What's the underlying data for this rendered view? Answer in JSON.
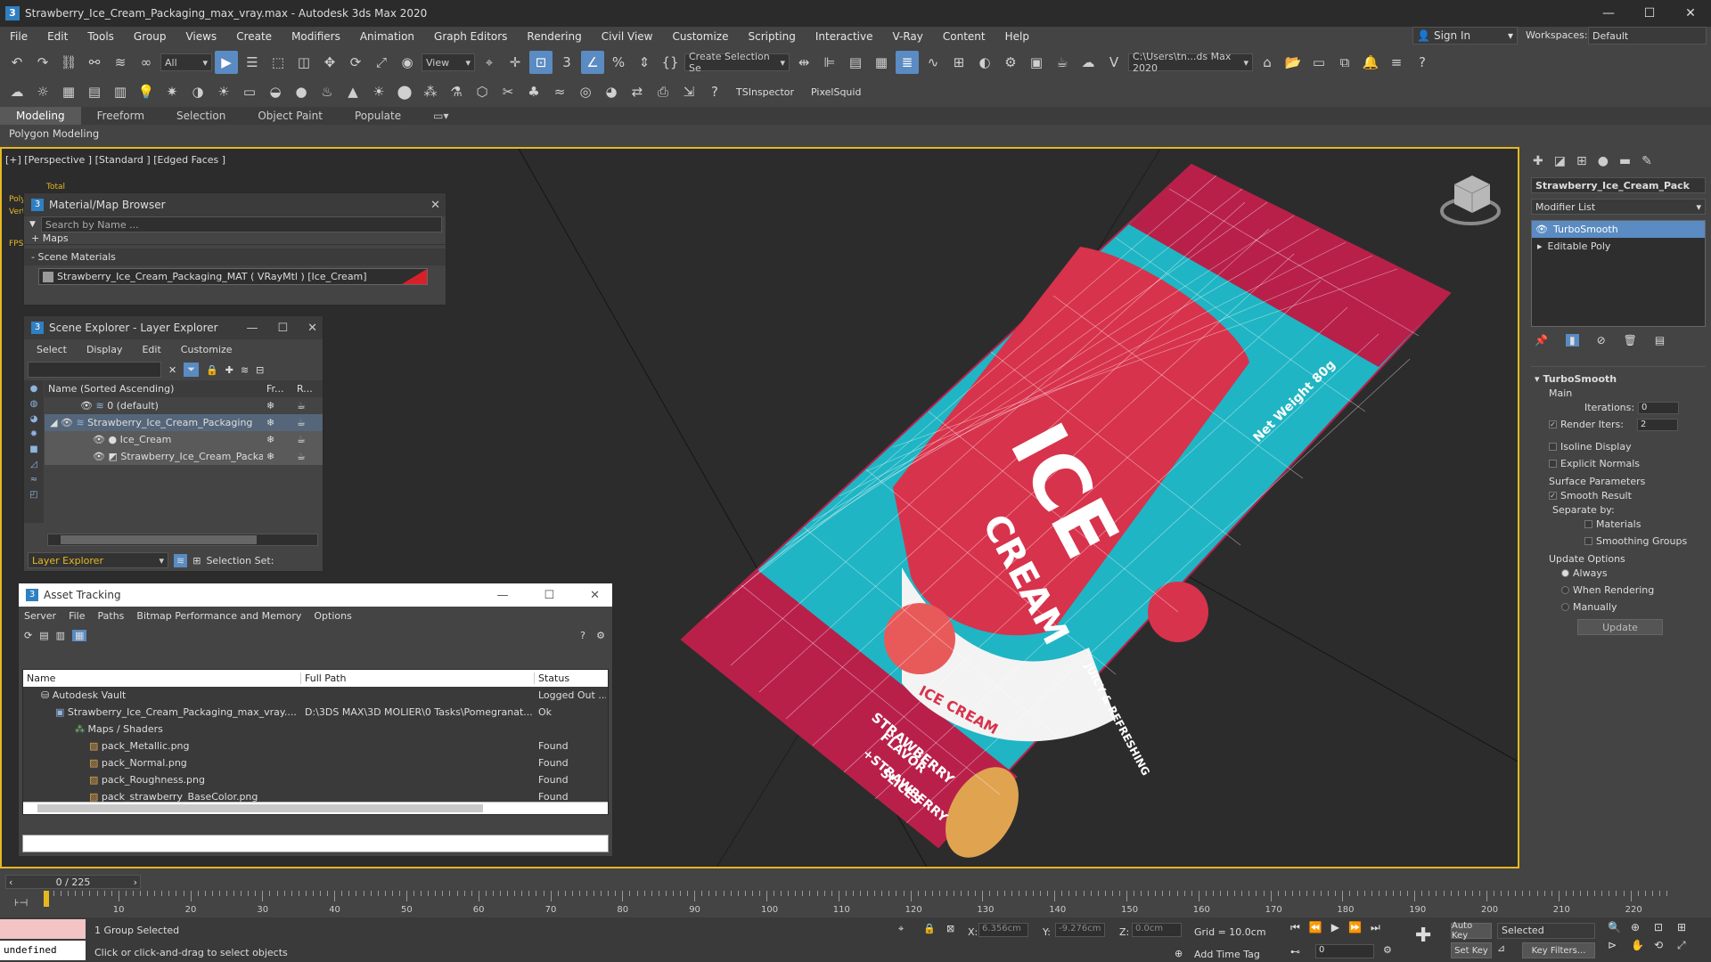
{
  "window": {
    "title": "Strawberry_Ice_Cream_Packaging_max_vray.max - Autodesk 3ds Max 2020",
    "app_icon": "3",
    "minimize": "—",
    "maximize": "☐",
    "close": "✕"
  },
  "menubar": [
    "File",
    "Edit",
    "Tools",
    "Group",
    "Views",
    "Create",
    "Modifiers",
    "Animation",
    "Graph Editors",
    "Rendering",
    "Civil View",
    "Customize",
    "Scripting",
    "Interactive",
    "V-Ray",
    "Content",
    "Help"
  ],
  "signin": {
    "label": "Sign In"
  },
  "workspaces": {
    "label": "Workspaces:",
    "value": "Default"
  },
  "toolbar1": {
    "selection_filter": "All",
    "ref_coord": "View",
    "named_selection": "Create Selection Se",
    "path": "C:\\Users\\tn...ds Max 2020"
  },
  "toolbar2": {
    "tsinspector": "TSInspector",
    "pixelsquid": "PixelSquid"
  },
  "ribbon": {
    "tabs": [
      "Modeling",
      "Freeform",
      "Selection",
      "Object Paint",
      "Populate"
    ],
    "active": "Modeling",
    "subtitle": "Polygon Modeling"
  },
  "viewport": {
    "label": "[+] [Perspective ] [Standard ] [Edged Faces ]",
    "stats_total": "Total",
    "stats_labels": [
      "Poly",
      "Vert",
      "FPS"
    ],
    "pack_text": {
      "line1": "ICE",
      "line2": "CREAM",
      "badge": "JUICY & REFRESHING",
      "small": "ICE CREAM",
      "flavor1": "STRAWBERRY",
      "flavor2": "FLAVOR",
      "flavor3": "+STRAWBERRY",
      "flavor4": "SLICES",
      "weight": "Net Weight 80g"
    }
  },
  "material_browser": {
    "title": "Material/Map Browser",
    "search_placeholder": "Search by Name ...",
    "maps": "+ Maps",
    "scene_materials": "- Scene Materials",
    "material": "Strawberry_Ice_Cream_Packaging_MAT  ( VRayMtl ) [Ice_Cream]"
  },
  "scene_explorer": {
    "title": "Scene Explorer - Layer Explorer",
    "menu": [
      "Select",
      "Display",
      "Edit",
      "Customize"
    ],
    "col_name": "Name (Sorted Ascending)",
    "col_fr": "Fr...",
    "col_r": "R...",
    "rows": [
      {
        "name": "0 (default)",
        "indent": 0
      },
      {
        "name": "Strawberry_Ice_Cream_Packaging",
        "indent": 0
      },
      {
        "name": "Ice_Cream",
        "indent": 1
      },
      {
        "name": "Strawberry_Ice_Cream_Packaging",
        "indent": 1
      }
    ],
    "explorer_dropdown": "Layer Explorer",
    "selection_set": "Selection Set:"
  },
  "asset_tracking": {
    "title": "Asset Tracking",
    "menu": [
      "Server",
      "File",
      "Paths",
      "Bitmap Performance and Memory",
      "Options"
    ],
    "columns": [
      "Name",
      "Full Path",
      "Status"
    ],
    "rows": [
      {
        "name": "Autodesk Vault",
        "path": "",
        "status": "Logged Out ...",
        "indent": 0
      },
      {
        "name": "Strawberry_Ice_Cream_Packaging_max_vray....",
        "path": "D:\\3DS MAX\\3D MOLIER\\0 Tasks\\Pomegranat...",
        "status": "Ok",
        "indent": 1
      },
      {
        "name": "Maps / Shaders",
        "path": "",
        "status": "",
        "indent": 2
      },
      {
        "name": "pack_Metallic.png",
        "path": "",
        "status": "Found",
        "indent": 3
      },
      {
        "name": "pack_Normal.png",
        "path": "",
        "status": "Found",
        "indent": 3
      },
      {
        "name": "pack_Roughness.png",
        "path": "",
        "status": "Found",
        "indent": 3
      },
      {
        "name": "pack_strawberry_BaseColor.png",
        "path": "",
        "status": "Found",
        "indent": 3
      }
    ]
  },
  "command_panel": {
    "object_name": "Strawberry_Ice_Cream_Pack",
    "modifier_list": "Modifier List",
    "stack": [
      "TurboSmooth",
      "Editable Poly"
    ],
    "rollout": "TurboSmooth",
    "main": "Main",
    "iterations_label": "Iterations:",
    "iterations": "0",
    "render_iters_label": "Render Iters:",
    "render_iters": "2",
    "isoline": "Isoline Display",
    "explicit_normals": "Explicit Normals",
    "surface_params": "Surface Parameters",
    "smooth_result": "Smooth Result",
    "separate_by": "Separate by:",
    "materials": "Materials",
    "smoothing_groups": "Smoothing Groups",
    "update_options": "Update Options",
    "always": "Always",
    "when_rendering": "When Rendering",
    "manually": "Manually",
    "update": "Update"
  },
  "timeline": {
    "frame": "0 / 225",
    "ticks": [
      "0",
      "10",
      "20",
      "30",
      "40",
      "50",
      "60",
      "70",
      "80",
      "90",
      "100",
      "110",
      "120",
      "130",
      "140",
      "150",
      "160",
      "170",
      "180",
      "190",
      "200",
      "210",
      "220"
    ]
  },
  "status": {
    "maxscript": "undefined",
    "selected": "1 Group Selected",
    "prompt": "Click or click-and-drag to select objects",
    "x_label": "X:",
    "x": "6.356cm",
    "y_label": "Y:",
    "y": "-9.276cm",
    "z_label": "Z:",
    "z": "0.0cm",
    "grid": "Grid = 10.0cm",
    "add_time_tag": "Add Time Tag",
    "auto_key": "Auto Key",
    "selected_dropdown": "Selected",
    "set_key": "Set Key",
    "key_filters": "Key Filters...",
    "frame_field": "0"
  },
  "colors": {
    "accent": "#5a8bc2",
    "viewport_border": "#e5b822",
    "pack_teal": "#1fb5c4",
    "pack_red": "#d8334c",
    "pack_pink": "#b8204a"
  }
}
